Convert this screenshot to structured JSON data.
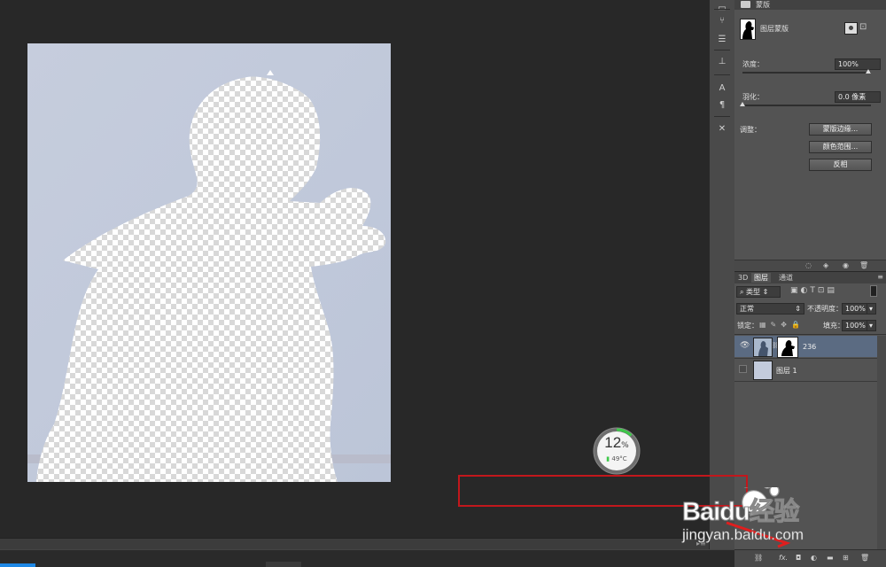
{
  "properties_panel": {
    "header_label": "蒙版",
    "mask_type": "图层蒙版",
    "density_label": "浓度：",
    "density_value": "100%",
    "feather_label": "羽化：",
    "feather_value": "0.0 像素",
    "adjust_label": "调整：",
    "buttons": [
      "蒙版边缘...",
      "颜色范围...",
      "反相"
    ]
  },
  "layers_panel": {
    "tabs": [
      "3D",
      "图层",
      "通道"
    ],
    "filter_kind": "类型",
    "blend_mode": "正常",
    "opacity_label": "不透明度：",
    "opacity_value": "100%",
    "lock_label": "锁定：",
    "fill_label": "填充：",
    "fill_value": "100%",
    "layers": [
      {
        "name": "236",
        "visible": true,
        "selected": true,
        "has_mask": true
      },
      {
        "name": "图层 1",
        "visible": false,
        "selected": false,
        "has_mask": false
      }
    ]
  },
  "toolstrip": {
    "icons": [
      "camera-icon",
      "brush-preset-icon",
      "adjust-icon",
      "align-icon",
      "character-icon",
      "paragraph-icon",
      "tools-icon"
    ]
  },
  "overlay": {
    "cpu_percent": "12",
    "cpu_unit": "%",
    "temperature": "49°C"
  },
  "watermark": {
    "brand": "Baidu经验",
    "url": "jingyan.baidu.com"
  },
  "colors": {
    "panel_bg": "#535353",
    "workspace_bg": "#282828",
    "canvas_bg": "#c3cbdc",
    "annotation_red": "#c2171c",
    "selected_layer": "#5b6b82",
    "gauge_green": "#3ec84a"
  }
}
